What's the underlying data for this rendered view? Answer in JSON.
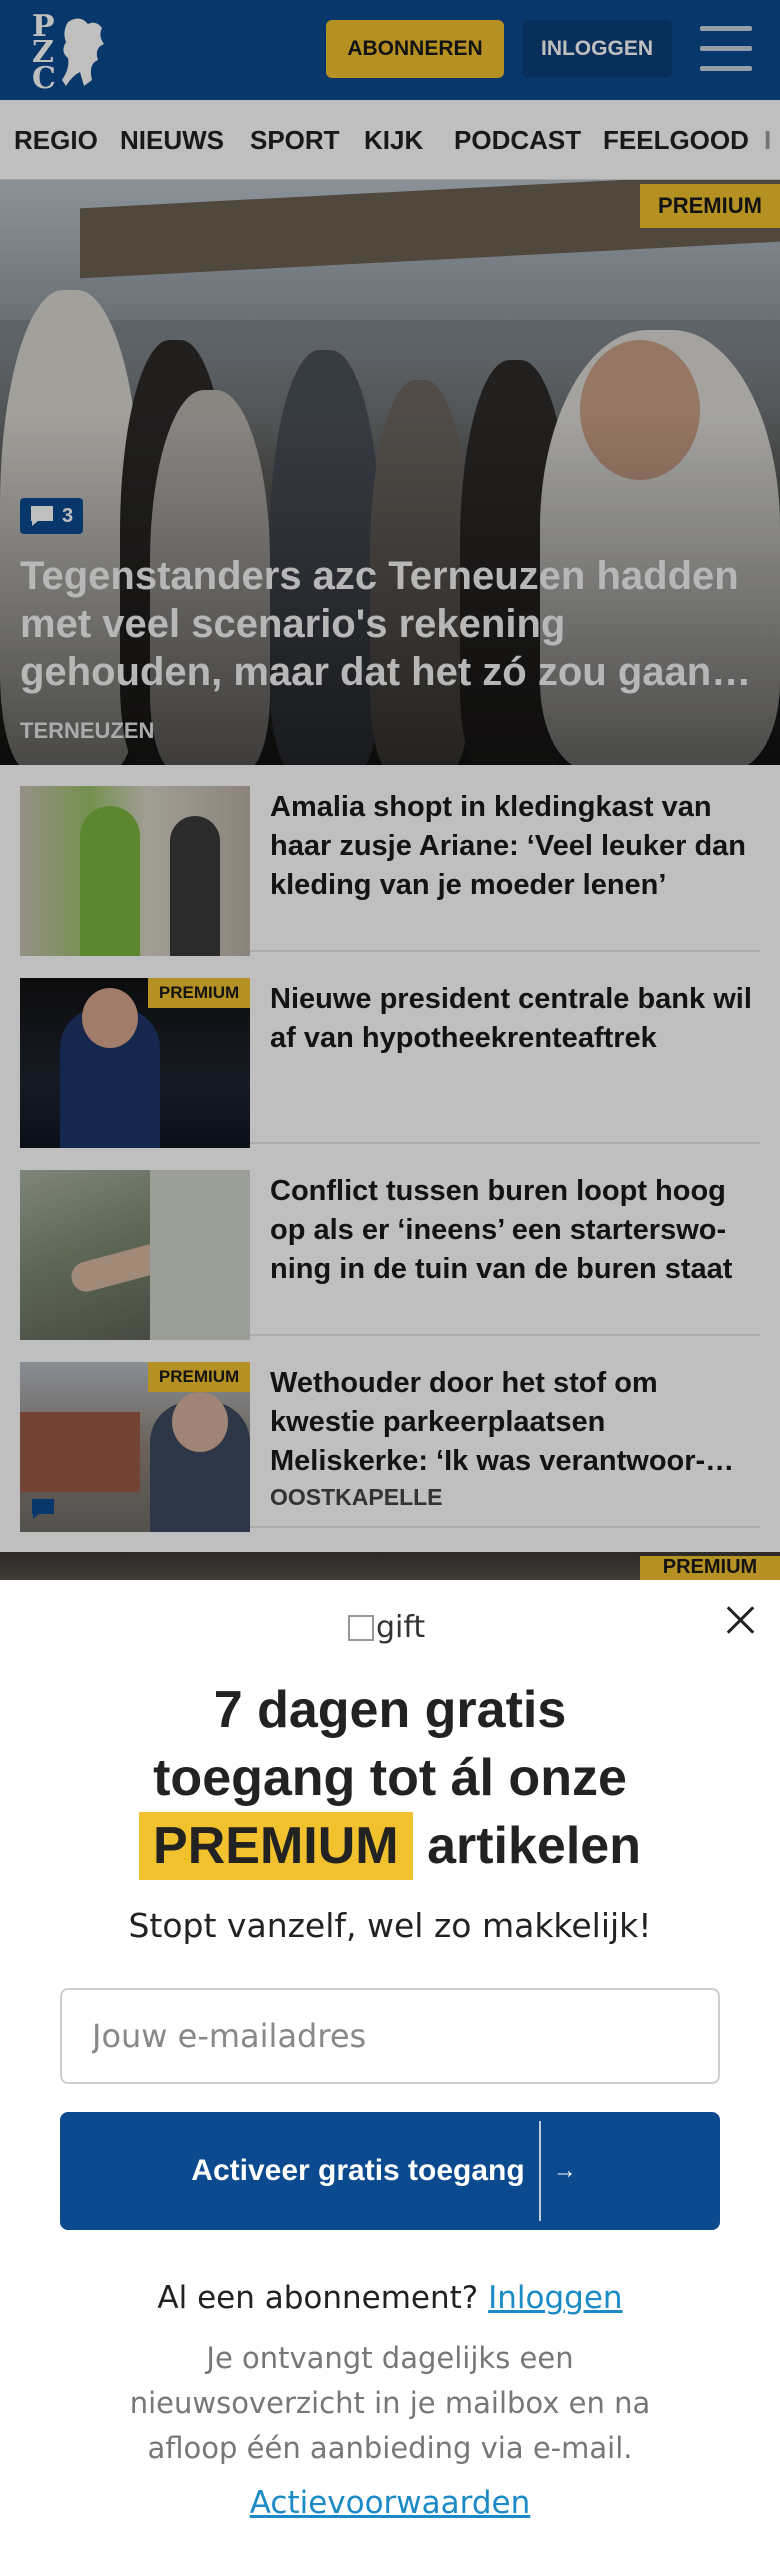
{
  "header": {
    "logo_letters": [
      "P",
      "Z",
      "C"
    ],
    "subscribe_label": "ABONNEREN",
    "login_label": "INLOGGEN",
    "brand_color": "#0b4a8f",
    "accent_color": "#f2c12e"
  },
  "nav": {
    "items": [
      "REGIO",
      "NIEUWS",
      "SPORT",
      "KIJK",
      "PODCAST",
      "FEELGOOD",
      "I"
    ]
  },
  "hero": {
    "premium_label": "PREMIUM",
    "comment_count": "3",
    "title": "Tegenstanders azc Terneuzen hadden met veel scenario's rekening gehouden, maar dat het zó zou gaan…",
    "location": "TERNEUZEN"
  },
  "articles": [
    {
      "title": "Amalia shopt in kledingkast van haar zusje Ariane: ‘Veel leuker dan kleding van je moeder lenen’",
      "premium": false,
      "location": ""
    },
    {
      "title": "Nieuwe president centrale bank wil af van hypotheekrenteaftrek",
      "premium": true,
      "premium_label": "PREMIUM",
      "location": ""
    },
    {
      "title": "Conflict tussen buren loopt hoog op als er ‘ineens’ een starterswo-ning in de tuin van de buren staat",
      "premium": false,
      "location": ""
    },
    {
      "title": "Wethouder door het stof om kwestie parkeerplaatsen Meliskerke: ‘Ik was verantwoor-…",
      "premium": true,
      "premium_label": "PREMIUM",
      "location": "OOSTKAPELLE"
    }
  ],
  "next_premium_label": "PREMIUM",
  "modal": {
    "gift_alt": "gift",
    "heading_line1": "7 dagen gratis",
    "heading_line2": "toegang tot ál onze",
    "heading_premium": "PREMIUM",
    "heading_line3_rest": "artikelen",
    "subheading": "Stopt vanzelf, wel zo makkelijk!",
    "email_placeholder": "Jouw e-mailadres",
    "cta_label": "Activeer gratis toegang",
    "cta_icon_alt": "arrow-right",
    "already_text": "Al een abonnement?",
    "already_link": "Inloggen",
    "info_text": "Je ontvangt dagelijks een nieuwsoverzicht in je mailbox en na afloop één aanbieding via e-mail.",
    "terms_link": "Actievoorwaarden"
  }
}
